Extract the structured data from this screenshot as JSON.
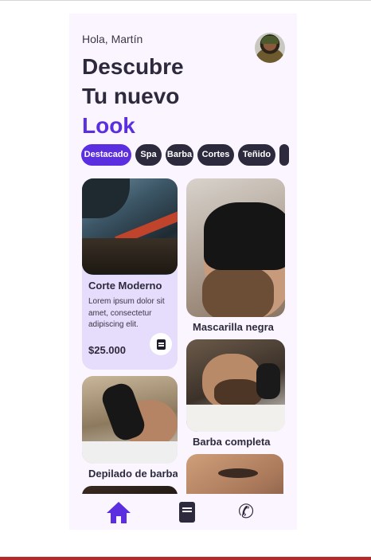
{
  "header": {
    "greeting": "Hola, Martín",
    "title_line1": "Descubre",
    "title_line2": "Tu nuevo",
    "title_accent": "Look"
  },
  "categories": [
    {
      "label": "Destacado",
      "active": true
    },
    {
      "label": "Spa",
      "active": false
    },
    {
      "label": "Barba",
      "active": false
    },
    {
      "label": "Cortes",
      "active": false
    },
    {
      "label": "Teñido",
      "active": false
    }
  ],
  "featured": {
    "title": "Corte Moderno",
    "description": "Lorem ipsum dolor sit amet, consectetur adipiscing elit.",
    "price": "$25.000"
  },
  "services": {
    "left": [
      {
        "title": "Depilado de barba"
      }
    ],
    "right": [
      {
        "title": "Mascarilla negra"
      },
      {
        "title": "Barba completa"
      }
    ]
  },
  "nav": {
    "items": [
      {
        "icon": "home-icon",
        "active": true
      },
      {
        "icon": "book-icon",
        "active": false
      },
      {
        "icon": "phone-icon",
        "active": false
      }
    ]
  },
  "colors": {
    "accent": "#5b2ee0",
    "dark": "#2e2a3d",
    "background": "#fbf5ff",
    "featured_card": "#e6dcfb"
  }
}
